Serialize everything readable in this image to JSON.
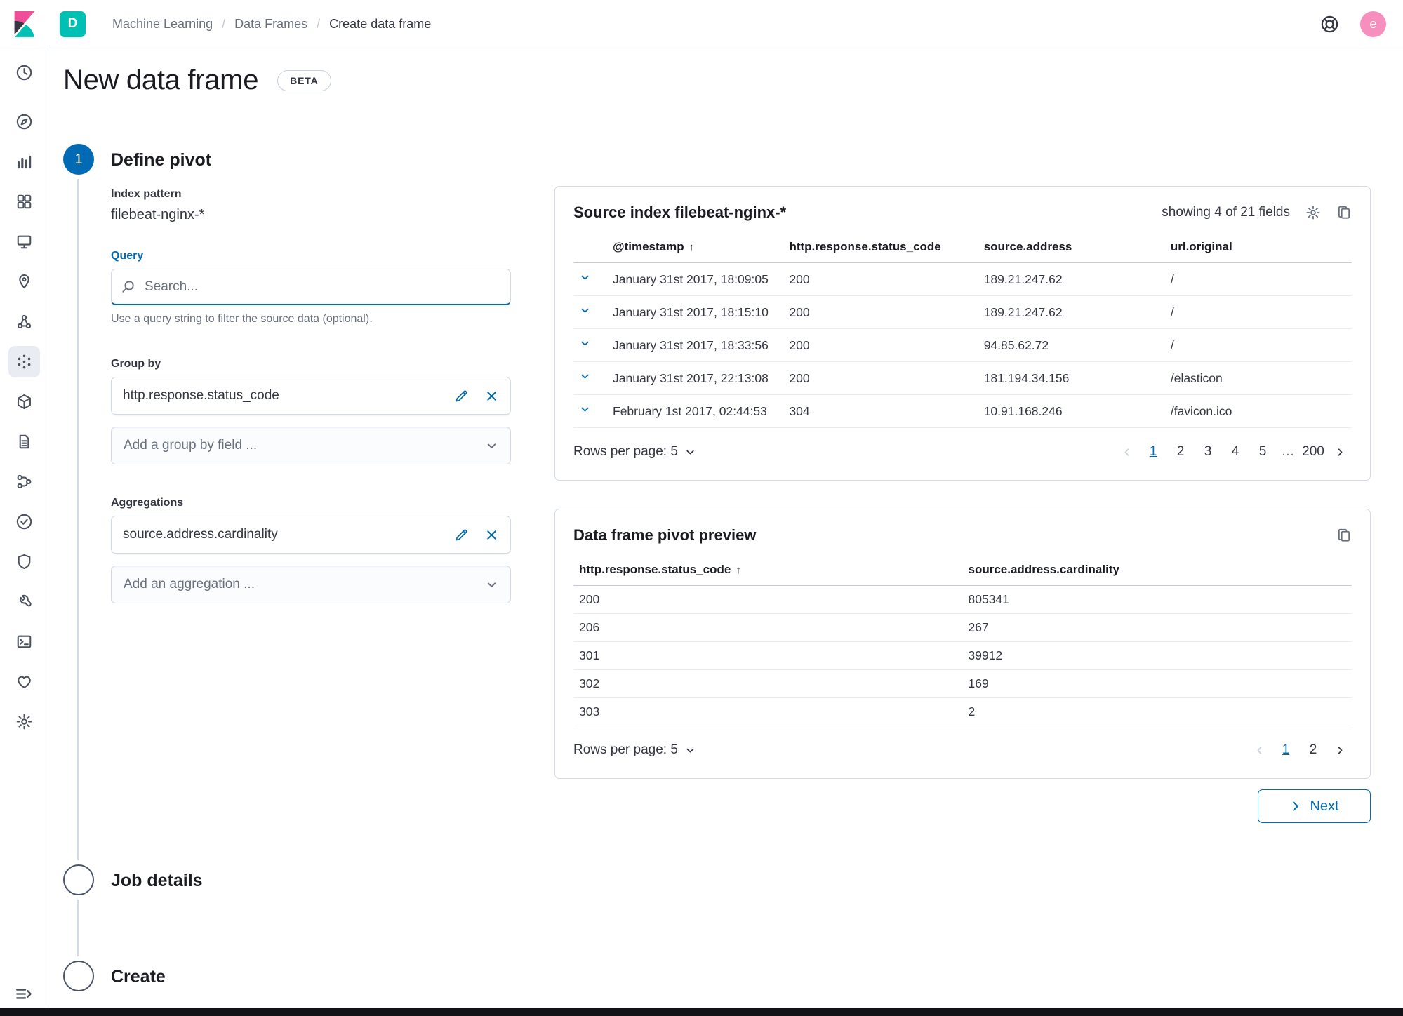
{
  "colors": {
    "primary": "#006BB4",
    "brand_teal": "#00BFB3",
    "brand_pink": "#F04E98",
    "text": "#343741",
    "subdued_text": "#69707D",
    "border": "#D3DAE6",
    "avatar_pink": "#F68FBE"
  },
  "header": {
    "space_badge": "D",
    "breadcrumbs": [
      "Machine Learning",
      "Data Frames",
      "Create data frame"
    ],
    "avatar_initial": "e",
    "icons": [
      "kibana-logo",
      "help-icon",
      "avatar"
    ]
  },
  "sidebar": {
    "items": [
      {
        "name": "recently-viewed",
        "icon": "clock",
        "selected": false
      },
      {
        "name": "discover",
        "icon": "discover",
        "selected": false
      },
      {
        "name": "visualize",
        "icon": "visualize",
        "selected": false
      },
      {
        "name": "dashboard",
        "icon": "dashboard",
        "selected": false
      },
      {
        "name": "canvas",
        "icon": "canvas",
        "selected": false
      },
      {
        "name": "maps",
        "icon": "maps",
        "selected": false
      },
      {
        "name": "graph",
        "icon": "graph",
        "selected": false
      },
      {
        "name": "machine-learning",
        "icon": "ml",
        "selected": true
      },
      {
        "name": "infrastructure",
        "icon": "infra",
        "selected": false
      },
      {
        "name": "logs",
        "icon": "logs",
        "selected": false
      },
      {
        "name": "apm",
        "icon": "apm",
        "selected": false
      },
      {
        "name": "uptime",
        "icon": "uptime",
        "selected": false
      },
      {
        "name": "siem",
        "icon": "siem",
        "selected": false
      },
      {
        "name": "dev-tools",
        "icon": "devtools",
        "selected": false
      },
      {
        "name": "console",
        "icon": "console",
        "selected": false
      },
      {
        "name": "monitoring",
        "icon": "monitoring",
        "selected": false
      },
      {
        "name": "management",
        "icon": "gear",
        "selected": false
      }
    ]
  },
  "page": {
    "title": "New data frame",
    "beta_badge": "BETA"
  },
  "steps": [
    {
      "number": "1",
      "label": "Define pivot",
      "status": "active"
    },
    {
      "number": "",
      "label": "Job details",
      "status": "incomplete"
    },
    {
      "number": "",
      "label": "Create",
      "status": "incomplete"
    }
  ],
  "form": {
    "index_pattern_label": "Index pattern",
    "index_pattern_value": "filebeat-nginx-*",
    "query_label": "Query",
    "query_placeholder": "Search...",
    "query_help": "Use a query string to filter the source data (optional).",
    "group_by_label": "Group by",
    "group_by_item": "http.response.status_code",
    "group_by_placeholder": "Add a group by field ...",
    "aggregations_label": "Aggregations",
    "aggregation_item": "source.address.cardinality",
    "aggregation_placeholder": "Add an aggregation ..."
  },
  "source_panel": {
    "title": "Source index filebeat-nginx-*",
    "fields_info": "showing 4 of 21 fields",
    "columns": [
      "@timestamp",
      "http.response.status_code",
      "source.address",
      "url.original"
    ],
    "sort_column": 0,
    "rows": [
      [
        "January 31st 2017, 18:09:05",
        "200",
        "189.21.247.62",
        "/"
      ],
      [
        "January 31st 2017, 18:15:10",
        "200",
        "189.21.247.62",
        "/"
      ],
      [
        "January 31st 2017, 18:33:56",
        "200",
        "94.85.62.72",
        "/"
      ],
      [
        "January 31st 2017, 22:13:08",
        "200",
        "181.194.34.156",
        "/elasticon"
      ],
      [
        "February 1st 2017, 02:44:53",
        "304",
        "10.91.168.246",
        "/favicon.ico"
      ]
    ],
    "rows_per_page": "Rows per page: 5",
    "pagination": {
      "pages": [
        "1",
        "2",
        "3",
        "4",
        "5",
        "…",
        "200"
      ],
      "active": "1"
    }
  },
  "pivot_panel": {
    "title": "Data frame pivot preview",
    "columns": [
      "http.response.status_code",
      "source.address.cardinality"
    ],
    "sort_column": 0,
    "rows": [
      [
        "200",
        "805341"
      ],
      [
        "206",
        "267"
      ],
      [
        "301",
        "39912"
      ],
      [
        "302",
        "169"
      ],
      [
        "303",
        "2"
      ]
    ],
    "rows_per_page": "Rows per page: 5",
    "pagination": {
      "pages": [
        "1",
        "2"
      ],
      "active": "1"
    }
  },
  "next_button": "Next"
}
